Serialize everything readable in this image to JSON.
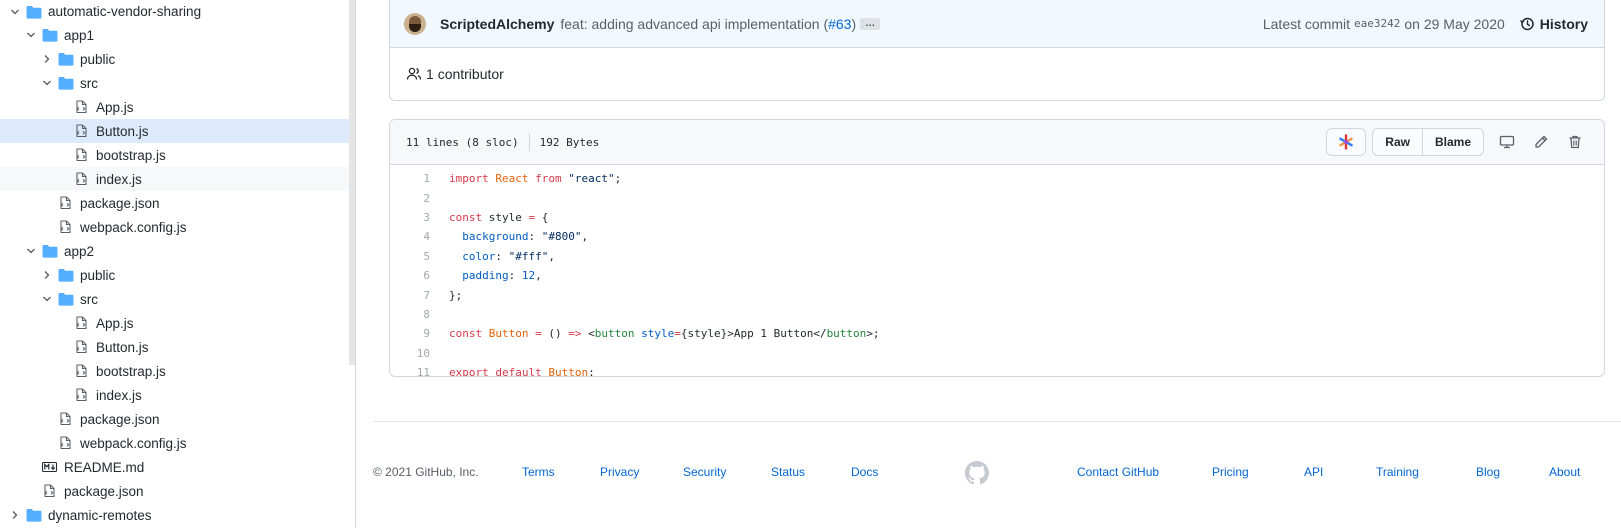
{
  "tree": [
    {
      "label": "automatic-vendor-sharing",
      "type": "folder",
      "chevron": "down"
    },
    {
      "label": "app1",
      "type": "folder",
      "chevron": "down"
    },
    {
      "label": "public",
      "type": "folder",
      "chevron": "right"
    },
    {
      "label": "src",
      "type": "folder",
      "chevron": "down"
    },
    {
      "label": "App.js",
      "type": "file"
    },
    {
      "label": "Button.js",
      "type": "file",
      "selected": true
    },
    {
      "label": "bootstrap.js",
      "type": "file"
    },
    {
      "label": "index.js",
      "type": "file",
      "hovered": true
    },
    {
      "label": "package.json",
      "type": "file"
    },
    {
      "label": "webpack.config.js",
      "type": "file"
    },
    {
      "label": "app2",
      "type": "folder",
      "chevron": "down"
    },
    {
      "label": "public",
      "type": "folder",
      "chevron": "right"
    },
    {
      "label": "src",
      "type": "folder",
      "chevron": "down"
    },
    {
      "label": "App.js",
      "type": "file"
    },
    {
      "label": "Button.js",
      "type": "file"
    },
    {
      "label": "bootstrap.js",
      "type": "file"
    },
    {
      "label": "index.js",
      "type": "file"
    },
    {
      "label": "package.json",
      "type": "file"
    },
    {
      "label": "webpack.config.js",
      "type": "file"
    },
    {
      "label": "README.md",
      "type": "markdown"
    },
    {
      "label": "package.json",
      "type": "file"
    },
    {
      "label": "dynamic-remotes",
      "type": "folder",
      "chevron": "right"
    }
  ],
  "commit": {
    "author": "ScriptedAlchemy",
    "message": "feat: adding advanced api implementation (",
    "pr": "#63",
    "pr_close": ")",
    "ellipsis": "…",
    "latest_label": "Latest commit",
    "sha": "eae3242",
    "date": "on 29 May 2020",
    "history": "History"
  },
  "contributors": {
    "count": "1",
    "label": "contributor"
  },
  "file": {
    "lines_info": "11 lines (8 sloc)",
    "size": "192 Bytes",
    "raw": "Raw",
    "blame": "Blame"
  },
  "code": [
    {
      "n": "1",
      "tokens": [
        [
          "k",
          "import"
        ],
        [
          "",
          ""
        ],
        [
          "v",
          " React"
        ],
        [
          "k",
          " from"
        ],
        [
          "s",
          " \"react\""
        ],
        [
          "",
          ";"
        ]
      ]
    },
    {
      "n": "2",
      "tokens": []
    },
    {
      "n": "3",
      "tokens": [
        [
          "k",
          "const"
        ],
        [
          "",
          " style "
        ],
        [
          "k",
          "="
        ],
        [
          "",
          " {"
        ]
      ]
    },
    {
      "n": "4",
      "tokens": [
        [
          "",
          "  "
        ],
        [
          "c",
          "background"
        ],
        [
          "",
          ": "
        ],
        [
          "s",
          "\"#800\""
        ],
        [
          "",
          ","
        ]
      ]
    },
    {
      "n": "5",
      "tokens": [
        [
          "",
          "  "
        ],
        [
          "c",
          "color"
        ],
        [
          "",
          ": "
        ],
        [
          "s",
          "\"#fff\""
        ],
        [
          "",
          ","
        ]
      ]
    },
    {
      "n": "6",
      "tokens": [
        [
          "",
          "  "
        ],
        [
          "c",
          "padding"
        ],
        [
          "",
          ": "
        ],
        [
          "c",
          "12"
        ],
        [
          "",
          ","
        ]
      ]
    },
    {
      "n": "7",
      "tokens": [
        [
          "",
          "};"
        ]
      ]
    },
    {
      "n": "8",
      "tokens": []
    },
    {
      "n": "9",
      "tokens": [
        [
          "k",
          "const"
        ],
        [
          "v",
          " Button"
        ],
        [
          "k",
          " ="
        ],
        [
          "",
          " () "
        ],
        [
          "k",
          "=>"
        ],
        [
          "",
          " <"
        ],
        [
          "t",
          "button"
        ],
        [
          "c",
          " style"
        ],
        [
          "k",
          "="
        ],
        [
          "",
          "{style}>App 1 Button</"
        ],
        [
          "t",
          "button"
        ],
        [
          "",
          ">;"
        ]
      ]
    },
    {
      "n": "10",
      "tokens": []
    },
    {
      "n": "11",
      "tokens": [
        [
          "k",
          "export"
        ],
        [
          "k",
          " default"
        ],
        [
          "v",
          " Button"
        ],
        [
          "",
          ";"
        ]
      ]
    }
  ],
  "footer": {
    "copyright": "© 2021 GitHub, Inc.",
    "left_links": [
      "Terms",
      "Privacy",
      "Security",
      "Status",
      "Docs"
    ],
    "right_links": [
      "Contact GitHub",
      "Pricing",
      "API",
      "Training",
      "Blog",
      "About"
    ]
  },
  "colors": {
    "link": "#0366d6",
    "folder": "#54aeff",
    "commit_bar": "#f1f8ff",
    "selected_row": "#ddeafb"
  }
}
